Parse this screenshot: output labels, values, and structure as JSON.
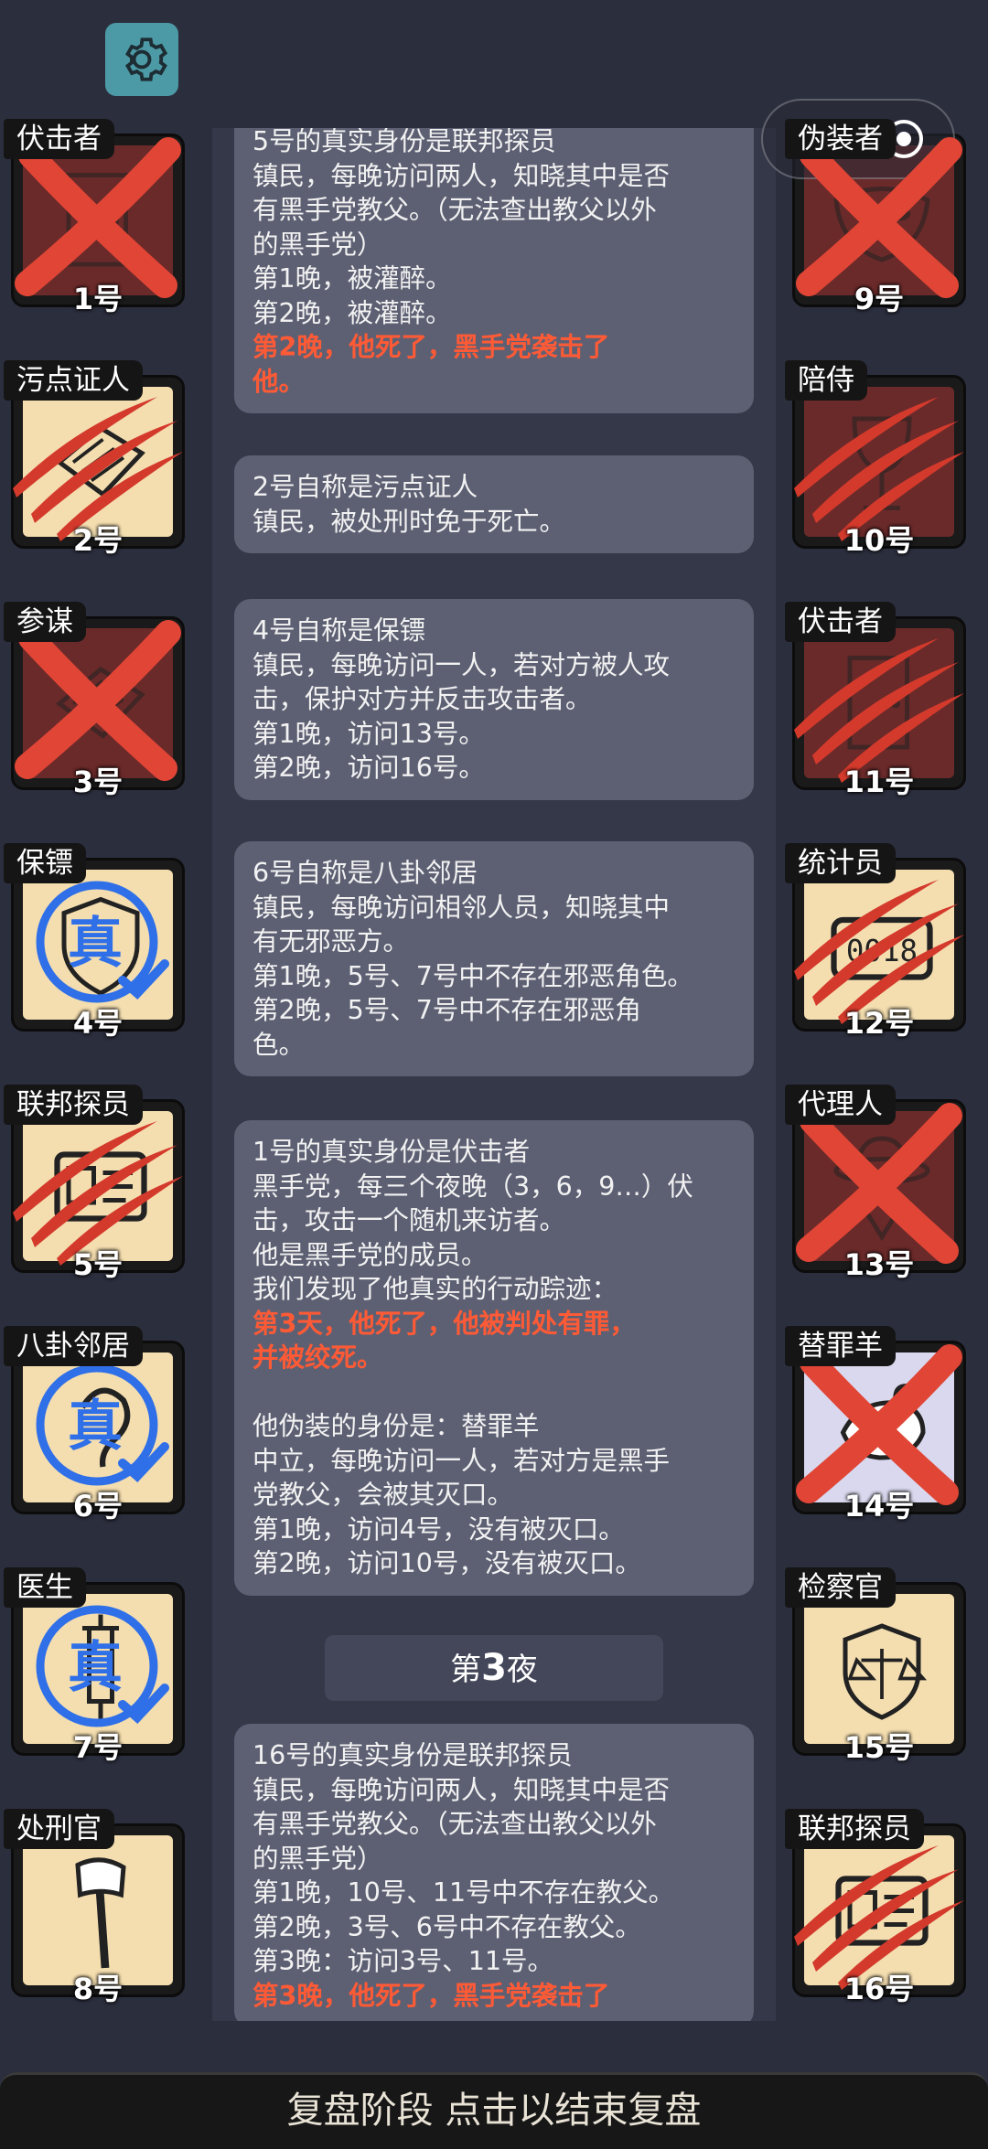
{
  "players_left": [
    {
      "label": "伏击者",
      "number": "1号",
      "state": "dead",
      "mark": "x",
      "art": "door"
    },
    {
      "label": "污点证人",
      "number": "2号",
      "state": "alive",
      "mark": "claw",
      "art": "paper"
    },
    {
      "label": "参谋",
      "number": "3号",
      "state": "dead",
      "mark": "x",
      "art": "paper"
    },
    {
      "label": "保镖",
      "number": "4号",
      "state": "alive",
      "mark": "true",
      "art": "shield"
    },
    {
      "label": "联邦探员",
      "number": "5号",
      "state": "alive",
      "mark": "claw",
      "art": "badge"
    },
    {
      "label": "八卦邻居",
      "number": "6号",
      "state": "alive",
      "mark": "true",
      "art": "ear"
    },
    {
      "label": "医生",
      "number": "7号",
      "state": "alive",
      "mark": "true",
      "art": "syringe"
    },
    {
      "label": "处刑官",
      "number": "8号",
      "state": "alive",
      "mark": "none",
      "art": "axe"
    }
  ],
  "players_right": [
    {
      "label": "伪装者",
      "number": "9号",
      "state": "dead",
      "mark": "x",
      "art": "mask"
    },
    {
      "label": "陪侍",
      "number": "10号",
      "state": "dead",
      "mark": "claw",
      "art": "glass"
    },
    {
      "label": "伏击者",
      "number": "11号",
      "state": "dead",
      "mark": "claw",
      "art": "door"
    },
    {
      "label": "统计员",
      "number": "12号",
      "state": "alive",
      "mark": "claw",
      "art": "counter"
    },
    {
      "label": "代理人",
      "number": "13号",
      "state": "dead",
      "mark": "x",
      "art": "hat"
    },
    {
      "label": "替罪羊",
      "number": "14号",
      "state": "lav",
      "mark": "x",
      "art": "goat"
    },
    {
      "label": "检察官",
      "number": "15号",
      "state": "alive",
      "mark": "none",
      "art": "scale"
    },
    {
      "label": "联邦探员",
      "number": "16号",
      "state": "alive",
      "mark": "claw",
      "art": "badge"
    }
  ],
  "true_mark_text": "真",
  "feed": [
    {
      "lines": [
        {
          "t": "5号的真实身份是联邦探员",
          "red": false
        },
        {
          "t": "镇民，每晚访问两人，知晓其中是否",
          "red": false
        },
        {
          "t": "有黑手党教父。（无法查出教父以外",
          "red": false
        },
        {
          "t": "的黑手党）",
          "red": false
        },
        {
          "t": "第1晚，被灌醉。",
          "red": false
        },
        {
          "t": "第2晚，被灌醉。",
          "red": false
        },
        {
          "t": "第2晚，他死了，黑手党袭击了",
          "red": true
        },
        {
          "t": "他。",
          "red": true
        }
      ]
    },
    {
      "lines": [
        {
          "t": "2号自称是污点证人",
          "red": false
        },
        {
          "t": "镇民，被处刑时免于死亡。",
          "red": false
        }
      ]
    },
    {
      "lines": [
        {
          "t": "4号自称是保镖",
          "red": false
        },
        {
          "t": "镇民，每晚访问一人，若对方被人攻",
          "red": false
        },
        {
          "t": "击，保护对方并反击攻击者。",
          "red": false
        },
        {
          "t": "第1晚，访问13号。",
          "red": false
        },
        {
          "t": "第2晚，访问16号。",
          "red": false
        }
      ]
    },
    {
      "lines": [
        {
          "t": "6号自称是八卦邻居",
          "red": false
        },
        {
          "t": "镇民，每晚访问相邻人员，知晓其中",
          "red": false
        },
        {
          "t": "有无邪恶方。",
          "red": false
        },
        {
          "t": "第1晚，5号、7号中不存在邪恶角色。",
          "red": false
        },
        {
          "t": "第2晚，5号、7号中不存在邪恶角",
          "red": false
        },
        {
          "t": "色。",
          "red": false
        }
      ]
    },
    {
      "lines": [
        {
          "t": "1号的真实身份是伏击者",
          "red": false
        },
        {
          "t": "黑手党，每三个夜晚（3，6，9…）伏",
          "red": false
        },
        {
          "t": "击，攻击一个随机来访者。",
          "red": false
        },
        {
          "t": "他是黑手党的成员。",
          "red": false
        },
        {
          "t": "我们发现了他真实的行动踪迹：",
          "red": false
        },
        {
          "t": "第3天，他死了，他被判处有罪，",
          "red": true
        },
        {
          "t": "并被绞死。",
          "red": true
        },
        {
          "t": " ",
          "red": false
        },
        {
          "t": "他伪装的身份是：替罪羊",
          "red": false
        },
        {
          "t": "中立，每晚访问一人，若对方是黑手",
          "red": false
        },
        {
          "t": "党教父，会被其灭口。",
          "red": false
        },
        {
          "t": "第1晚，访问4号，没有被灭口。",
          "red": false
        },
        {
          "t": "第2晚，访问10号，没有被灭口。",
          "red": false
        }
      ]
    },
    {
      "lines": [
        {
          "t": "16号的真实身份是联邦探员",
          "red": false
        },
        {
          "t": "镇民，每晚访问两人，知晓其中是否",
          "red": false
        },
        {
          "t": "有黑手党教父。（无法查出教父以外",
          "red": false
        },
        {
          "t": "的黑手党）",
          "red": false
        },
        {
          "t": "第1晚，10号、11号中不存在教父。",
          "red": false
        },
        {
          "t": "第2晚，3号、6号中不存在教父。",
          "red": false
        },
        {
          "t": "第3晚：访问3号、11号。",
          "red": false
        },
        {
          "t": "第3晚，他死了，黑手党袭击了",
          "red": true
        }
      ]
    }
  ],
  "night_divider": {
    "prefix": "第",
    "number": "3",
    "suffix": "夜"
  },
  "bottom_button": "复盘阶段  点击以结束复盘",
  "colors": {
    "red_text": "#ff5a36",
    "true_blue": "#2f6fe8",
    "x_red": "#e04535",
    "dead_bg": "#6b2a2a",
    "alive_bg": "#f4deb0"
  }
}
